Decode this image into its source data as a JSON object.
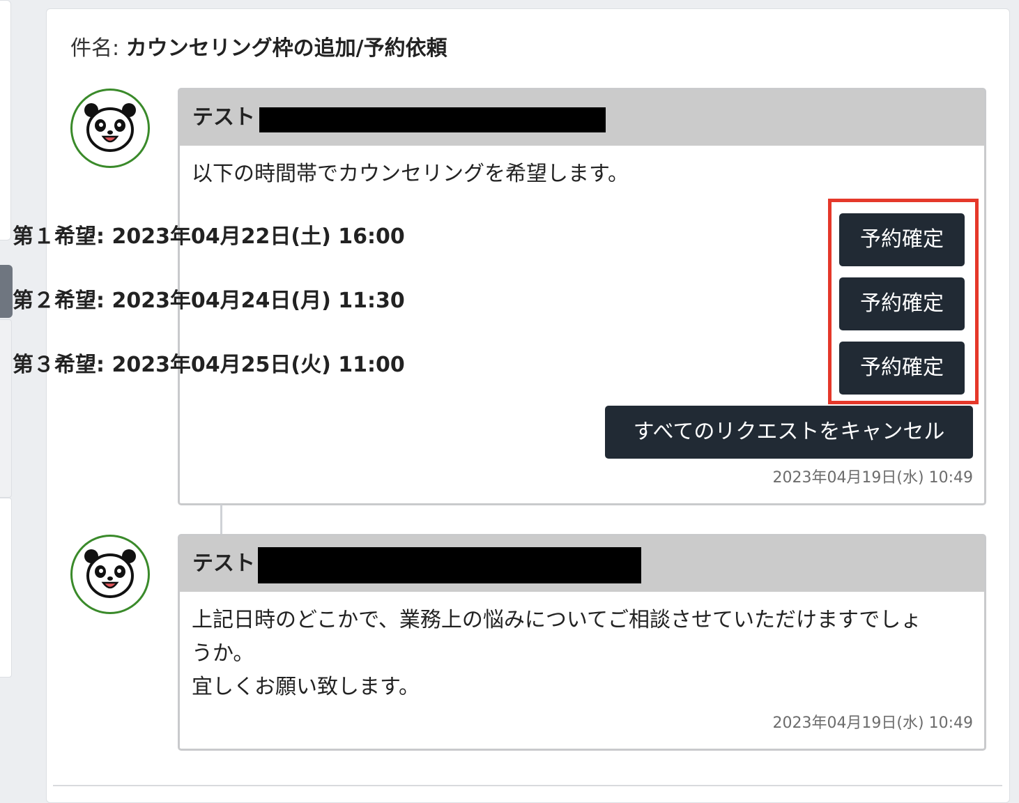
{
  "subject": {
    "label": "件名:",
    "value": "カウンセリング枠の追加/予約依頼"
  },
  "messages": [
    {
      "sender": "テスト",
      "avatar_icon": "panda-icon",
      "intro": "以下の時間帯でカウンセリングを希望します。",
      "preferences": [
        {
          "label": "第１希望: 2023年04月22日(土) 16:00",
          "button": "予約確定"
        },
        {
          "label": "第２希望: 2023年04月24日(月) 11:30",
          "button": "予約確定"
        },
        {
          "label": "第３希望: 2023年04月25日(火) 11:00",
          "button": "予約確定"
        }
      ],
      "cancel_all_label": "すべてのリクエストをキャンセル",
      "timestamp": "2023年04月19日(水) 10:49"
    },
    {
      "sender": "テスト",
      "avatar_icon": "panda-icon",
      "body_lines": [
        "上記日時のどこかで、業務上の悩みについてご相談させていただけますでしょ",
        "うか。",
        "宜しくお願い致します。"
      ],
      "timestamp": "2023年04月19日(水) 10:49"
    }
  ],
  "colors": {
    "button_bg": "#212a34",
    "highlight": "#e5382a",
    "avatar_ring": "#3a8a2a",
    "header_bg": "#cbcbcb"
  }
}
